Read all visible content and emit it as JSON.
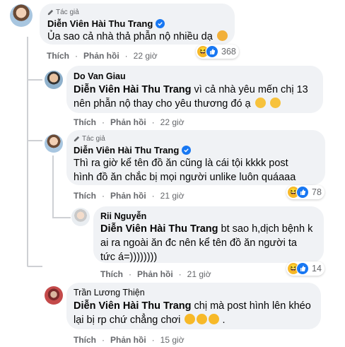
{
  "labels": {
    "author_badge": "Tác giả",
    "like": "Thích",
    "reply": "Phản hồi",
    "dot": "·"
  },
  "comments": [
    {
      "name": "Diễn Viên Hài Thu Trang",
      "verified": true,
      "author": true,
      "text": "Ủa sao cả nhà thả phẫn nộ nhiều dạ",
      "time": "22 giờ",
      "reaction_count": "368"
    },
    {
      "name": "Do Van Giau",
      "mention": "Diễn Viên Hài Thu Trang",
      "text_line1": " vì cả nhà yêu mến chị 13",
      "text_line2": "nên phẫn nộ thay cho yêu thương đó ạ",
      "time": "22 giờ"
    },
    {
      "name": "Diễn Viên Hài Thu Trang",
      "verified": true,
      "author": true,
      "text_line1": "Thì ra giờ kể tên đồ ăn cũng là cái tội kkkk post",
      "text_line2": "hình đồ ăn chắc bị mọi người unlike luôn quáaaa",
      "time": "21 giờ",
      "reaction_count": "78"
    },
    {
      "name": "Rii Nguyễn",
      "mention": "Diễn Viên Hài Thu Trang",
      "text_line1": " bt sao h,dịch bệnh k",
      "text_line2": "ai ra ngoài ăn đc nên kể tên đồ ăn người ta",
      "text_line3": "tức á=))))))))",
      "time": "21 giờ",
      "reaction_count": "14"
    },
    {
      "name": "Trần Lương Thiện",
      "mention": "Diễn Viên Hài Thu Trang",
      "text_line1": " chị mà post hình lên khéo",
      "text_line2": "lại bị rp chứ chẳng chơi",
      "time": "15 giờ"
    }
  ],
  "colors": {
    "bubble": "#f0f2f5",
    "meta": "#65676b",
    "verified": "#1877f2",
    "haha": "#f7b928"
  }
}
